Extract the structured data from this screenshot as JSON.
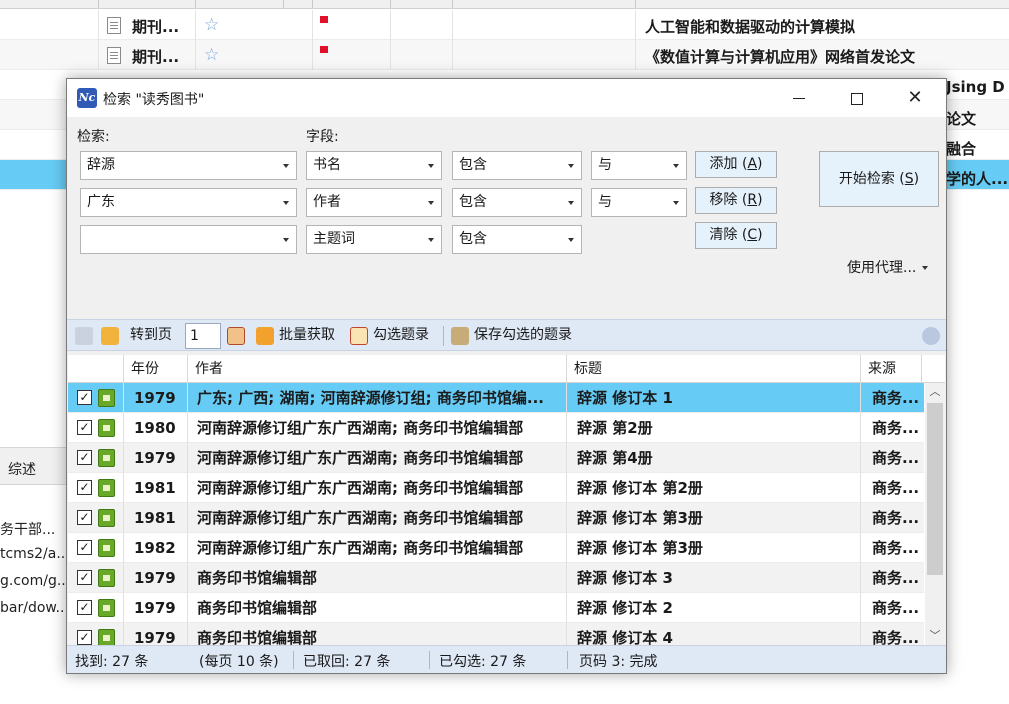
{
  "background": {
    "rows": [
      {
        "type": "期刊...",
        "title": "人工智能和数据驱动的计算模拟"
      },
      {
        "type": "期刊...",
        "title": "《数值计算与计算机应用》网络首发论文"
      }
    ],
    "right_snippets": [
      "Jsing D",
      "论文",
      "融合",
      "学的人..."
    ],
    "lower_tab": "综述",
    "lower_items": [
      "务干部...",
      "tcms2/a...",
      "g.com/g...",
      "bar/dow..."
    ]
  },
  "dialog": {
    "title": "检索 \"读秀图书\"",
    "icon_text": "Nc",
    "labels": {
      "search": "检索:",
      "field": "字段:"
    },
    "criteria": [
      {
        "value": "辞源",
        "field": "书名",
        "op": "包含",
        "logic": "与"
      },
      {
        "value": "广东",
        "field": "作者",
        "op": "包含",
        "logic": "与"
      },
      {
        "value": "",
        "field": "主题词",
        "op": "包含",
        "logic": ""
      }
    ],
    "buttons": {
      "add": "添加",
      "add_key": "A",
      "remove": "移除",
      "remove_key": "R",
      "clear": "清除",
      "clear_key": "C",
      "start": "开始检索",
      "start_key": "S"
    },
    "proxy": "使用代理...",
    "toolbar": {
      "goto": "转到页",
      "page": "1",
      "batch": "批量获取",
      "check": "勾选题录",
      "save": "保存勾选的题录"
    },
    "columns": {
      "year": "年份",
      "author": "作者",
      "title": "标题",
      "source": "来源"
    },
    "results": [
      {
        "year": "1979",
        "author": "广东; 广西; 湖南; 河南辞源修订组; 商务印书馆编...",
        "title": "辞源  修订本  1",
        "source": "商务..."
      },
      {
        "year": "1980",
        "author": "河南辞源修订组广东广西湖南; 商务印书馆编辑部",
        "title": "辞源  第2册",
        "source": "商务..."
      },
      {
        "year": "1979",
        "author": "河南辞源修订组广东广西湖南; 商务印书馆编辑部",
        "title": "辞源  第4册",
        "source": "商务..."
      },
      {
        "year": "1981",
        "author": "河南辞源修订组广东广西湖南; 商务印书馆编辑部",
        "title": "辞源  修订本  第2册",
        "source": "商务..."
      },
      {
        "year": "1981",
        "author": "河南辞源修订组广东广西湖南; 商务印书馆编辑部",
        "title": "辞源  修订本  第3册",
        "source": "商务..."
      },
      {
        "year": "1982",
        "author": "河南辞源修订组广东广西湖南; 商务印书馆编辑部",
        "title": "辞源  修订本  第3册",
        "source": "商务..."
      },
      {
        "year": "1979",
        "author": "商务印书馆编辑部",
        "title": "辞源  修订本  3",
        "source": "商务..."
      },
      {
        "year": "1979",
        "author": "商务印书馆编辑部",
        "title": "辞源  修订本  2",
        "source": "商务..."
      },
      {
        "year": "1979",
        "author": "商务印书馆编辑部",
        "title": "辞源  修订本  4",
        "source": "商务..."
      }
    ],
    "status": {
      "found": "找到: 27 条",
      "per_page": "(每页 10 条)",
      "fetched": "已取回: 27 条",
      "checked": "已勾选: 27 条",
      "page": "页码 3: 完成"
    }
  },
  "colors": {
    "selection": "#66ccf5",
    "toolbar": "#dfe8f5",
    "accent": "#2f5bb7"
  }
}
